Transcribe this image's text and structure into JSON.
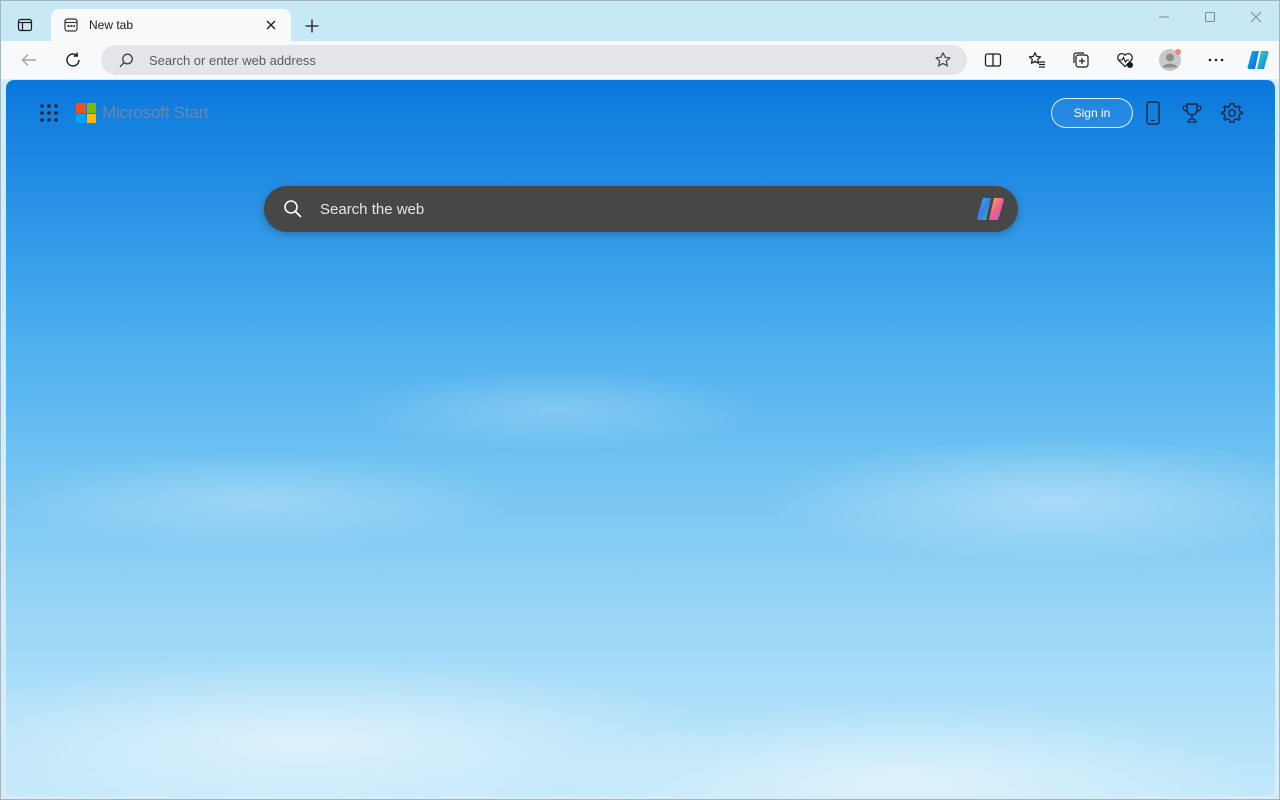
{
  "browser": {
    "tab": {
      "title": "New tab"
    },
    "address_bar": {
      "placeholder": "Search or enter web address",
      "value": ""
    },
    "icons": {
      "tab_actions": "tab-actions-icon",
      "favicon": "new-tab-page-icon",
      "close_tab": "close-icon",
      "new_tab": "plus-icon",
      "minimize": "minimize-icon",
      "maximize": "maximize-icon",
      "close_window": "close-window-icon",
      "back": "back-arrow-icon",
      "refresh": "refresh-icon",
      "favorite": "star-icon",
      "split_screen": "split-screen-icon",
      "favorites": "favorites-icon",
      "collections": "collections-icon",
      "browser_essentials": "heart-pulse-icon",
      "profile": "profile-avatar-icon",
      "more": "more-icon",
      "copilot": "copilot-icon"
    }
  },
  "page": {
    "brand": "Microsoft Start",
    "sign_in_label": "Sign in",
    "search": {
      "placeholder": "Search the web",
      "value": ""
    },
    "icons": {
      "apps": "app-launcher-icon",
      "phone": "phone-icon",
      "rewards": "rewards-trophy-icon",
      "settings": "gear-icon",
      "search": "search-icon",
      "copilot": "copilot-icon"
    }
  },
  "colors": {
    "ms_red": "#f25022",
    "ms_green": "#7fba00",
    "ms_blue": "#00a4ef",
    "ms_yellow": "#ffb900",
    "search_bg": "#474747",
    "sky_top": "#0a78dc",
    "sky_bottom": "#c2e8fa"
  }
}
